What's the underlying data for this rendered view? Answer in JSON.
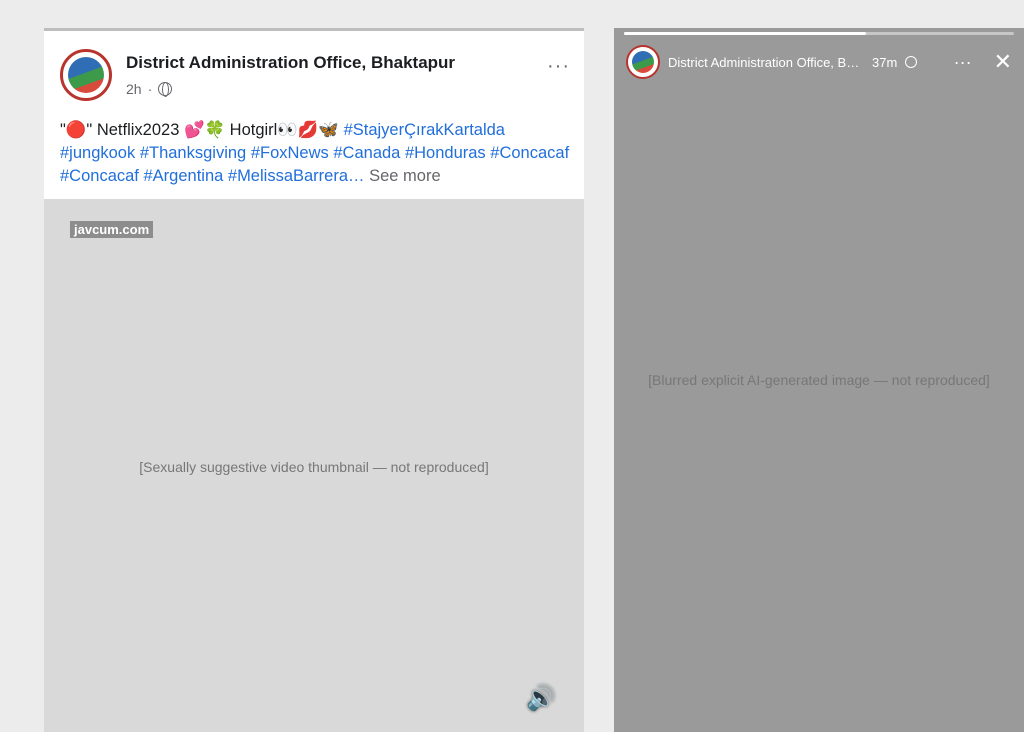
{
  "post": {
    "page_name": "District Administration Office, Bhaktapur",
    "time": "2h",
    "more_icon": "···",
    "caption_lead": "\"🔴\" Netflix2023 💕🍀 Hotgirl👀💋🦋",
    "hashtags": [
      "#StajyerÇırakKartalda",
      "#jungkook",
      "#Thanksgiving",
      "#FoxNews",
      "#Canada",
      "#Honduras",
      "#Concacaf",
      "#Concacaf",
      "#Argentina",
      "#MelissaBarrera…"
    ],
    "see_more": "See more",
    "watermark": "javcum.com",
    "media_placeholder": "[Sexually suggestive video thumbnail — not reproduced]",
    "sound_icon": "🔊"
  },
  "story": {
    "page_name": "District Administration Office, Bh...",
    "time": "37m",
    "more_icon": "···",
    "close_icon": "✕",
    "progress": 0.62,
    "media_placeholder": "[Blurred explicit AI-generated image — not reproduced]"
  }
}
